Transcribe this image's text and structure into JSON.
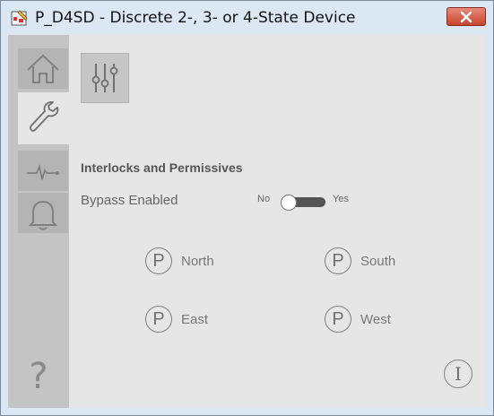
{
  "window": {
    "title": "P_D4SD - Discrete 2-, 3- or 4-State Device",
    "close_icon": "close-icon"
  },
  "sidebar": {
    "items": [
      {
        "name": "home",
        "icon": "home-icon"
      },
      {
        "name": "maintenance",
        "icon": "wrench-icon",
        "active": true
      },
      {
        "name": "trends",
        "icon": "trend-icon"
      },
      {
        "name": "alarms",
        "icon": "bell-icon"
      }
    ],
    "help_symbol": "?"
  },
  "toolbar": {
    "settings_icon": "sliders-icon"
  },
  "interlocks": {
    "title": "Interlocks and Permissives",
    "bypass_label": "Bypass Enabled",
    "toggle_off_label": "No",
    "toggle_on_label": "Yes",
    "bypass_enabled": false
  },
  "permissives": [
    {
      "symbol": "P",
      "label": "North"
    },
    {
      "symbol": "P",
      "label": "South"
    },
    {
      "symbol": "P",
      "label": "East"
    },
    {
      "symbol": "P",
      "label": "West"
    }
  ],
  "info_symbol": "I",
  "colors": {
    "title_bar": "#dbe8f3",
    "close_button": "#c4442c",
    "sidebar": "#c4c4c4",
    "content": "#e6e6e6",
    "toggle_track": "#555555"
  }
}
